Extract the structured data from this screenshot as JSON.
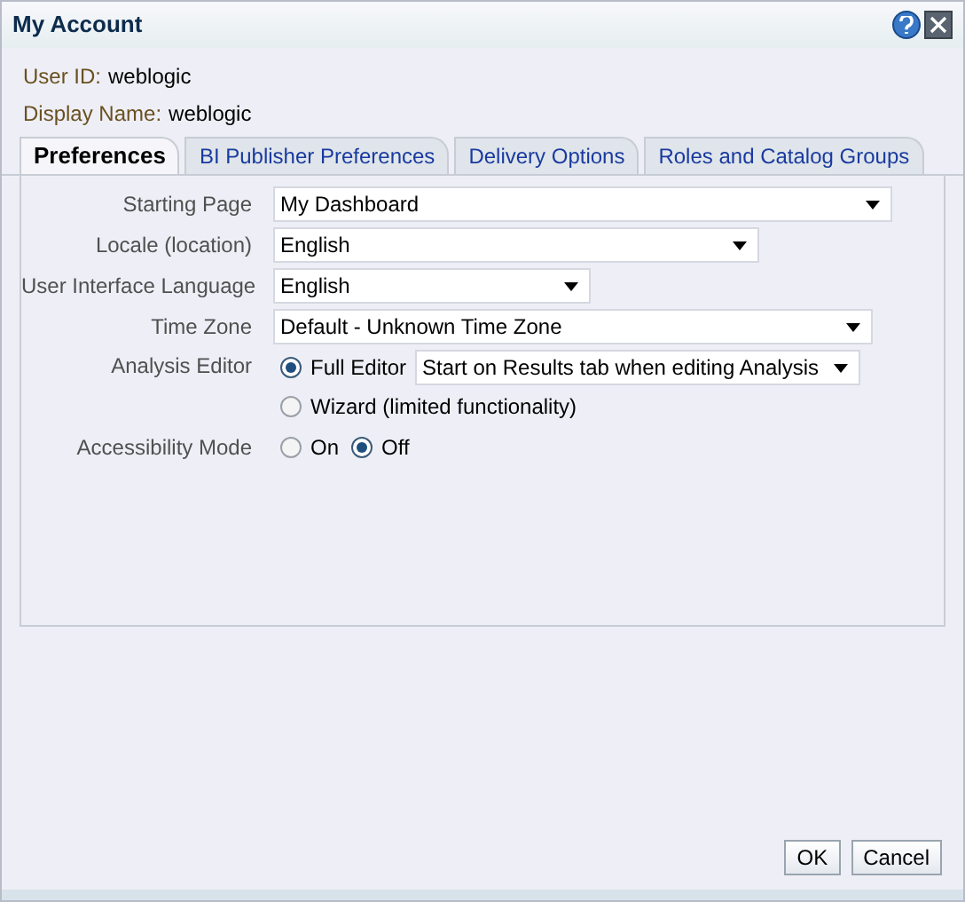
{
  "dialog": {
    "title": "My Account"
  },
  "user_info": [
    {
      "label": "User ID:",
      "value": "weblogic"
    },
    {
      "label": "Display Name:",
      "value": "weblogic"
    }
  ],
  "tabs": [
    {
      "label": "Preferences",
      "selected": true
    },
    {
      "label": "BI Publisher Preferences",
      "selected": false
    },
    {
      "label": "Delivery Options",
      "selected": false
    },
    {
      "label": "Roles and Catalog Groups",
      "selected": false
    }
  ],
  "preferences": [
    {
      "kind": "select",
      "label": "Starting Page",
      "value": "My Dashboard"
    },
    {
      "kind": "select",
      "label": "Locale (location)",
      "value": "English"
    },
    {
      "kind": "select",
      "label": "User Interface Language",
      "value": "English"
    },
    {
      "kind": "select",
      "label": "Time Zone",
      "value": "Default - Unknown Time Zone"
    },
    {
      "kind": "radio_stack",
      "label": "Analysis Editor",
      "options": [
        {
          "label": "Full Editor",
          "selected": true,
          "select_value": "Start on Results tab when editing Analysis"
        },
        {
          "label": "Wizard (limited functionality)",
          "selected": false
        }
      ]
    },
    {
      "kind": "radio_inline",
      "label": "Accessibility Mode",
      "options": [
        {
          "label": "On",
          "selected": false
        },
        {
          "label": "Off",
          "selected": true
        }
      ]
    }
  ],
  "buttons": [
    "OK",
    "Cancel"
  ]
}
